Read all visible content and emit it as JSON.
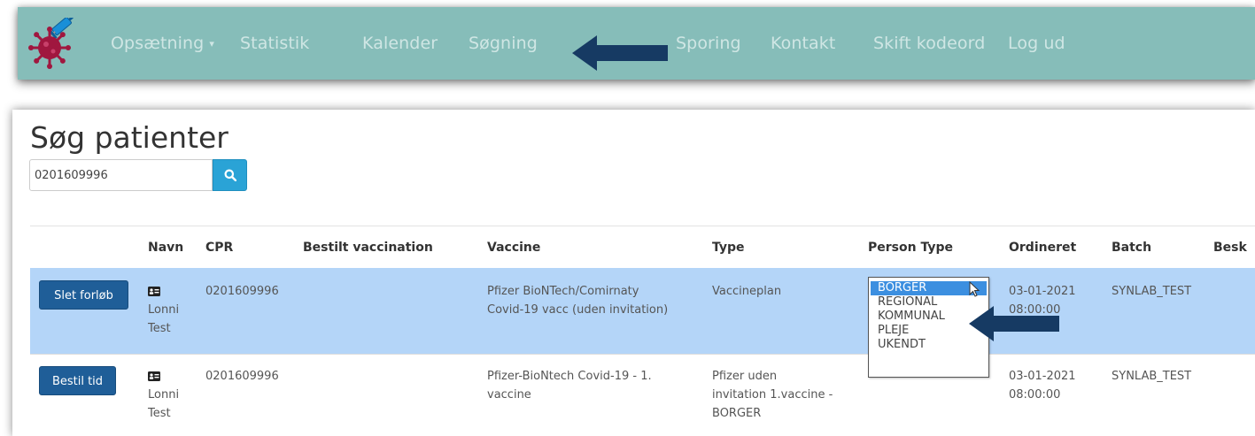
{
  "nav": {
    "items": [
      {
        "label": "Opsætning",
        "has_caret": true
      },
      {
        "label": "Statistik"
      },
      {
        "label": "Kalender"
      },
      {
        "label": "Søgning"
      },
      {
        "label": "Sporing"
      },
      {
        "label": "Kontakt"
      },
      {
        "label": "Skift kodeord"
      },
      {
        "label": "Log ud"
      }
    ],
    "caret": "▾"
  },
  "page": {
    "title": "Søg patienter"
  },
  "search": {
    "value": "0201609996",
    "button_icon": "search-icon"
  },
  "table": {
    "headers": [
      "Navn",
      "CPR",
      "Bestilt vaccination",
      "Vaccine",
      "Type",
      "Person Type",
      "Ordineret",
      "Batch",
      "Besk"
    ],
    "rows": [
      {
        "action": "Slet forløb",
        "name_first": "Lonni",
        "name_last": "Test",
        "cpr": "0201609996",
        "bestilt": "",
        "vaccine_line1": "Pfizer BioNTech/Comirnaty",
        "vaccine_line2": "Covid-19 vacc (uden invitation)",
        "type_line1": "Vaccineplan",
        "ordineret_date": "03-01-2021",
        "ordineret_time": "08:00:00",
        "batch": "SYNLAB_TEST",
        "selected": true
      },
      {
        "action": "Bestil tid",
        "name_first": "Lonni",
        "name_last": "Test",
        "cpr": "0201609996",
        "bestilt": "",
        "vaccine_line1": "Pfizer-BioNtech Covid-19 - 1.",
        "vaccine_line2": "vaccine",
        "type_line1": "Pfizer uden",
        "type_line2": "invitation 1.vaccine -",
        "type_line3": "BORGER",
        "ordineret_date": "03-01-2021",
        "ordineret_time": "08:00:00",
        "batch": "SYNLAB_TEST",
        "selected": false
      }
    ]
  },
  "person_type_dropdown": {
    "options": [
      "BORGER",
      "REGIONAL",
      "KOMMUNAL",
      "PLEJE",
      "UKENDT"
    ],
    "selected": "BORGER"
  },
  "colors": {
    "nav_bg": "#86bdb9",
    "nav_text": "#cfe6e4",
    "selected_row": "#b4d5f8",
    "button": "#1f5e98",
    "search_button": "#2aa3d6",
    "annotation_arrow": "#163a63"
  }
}
